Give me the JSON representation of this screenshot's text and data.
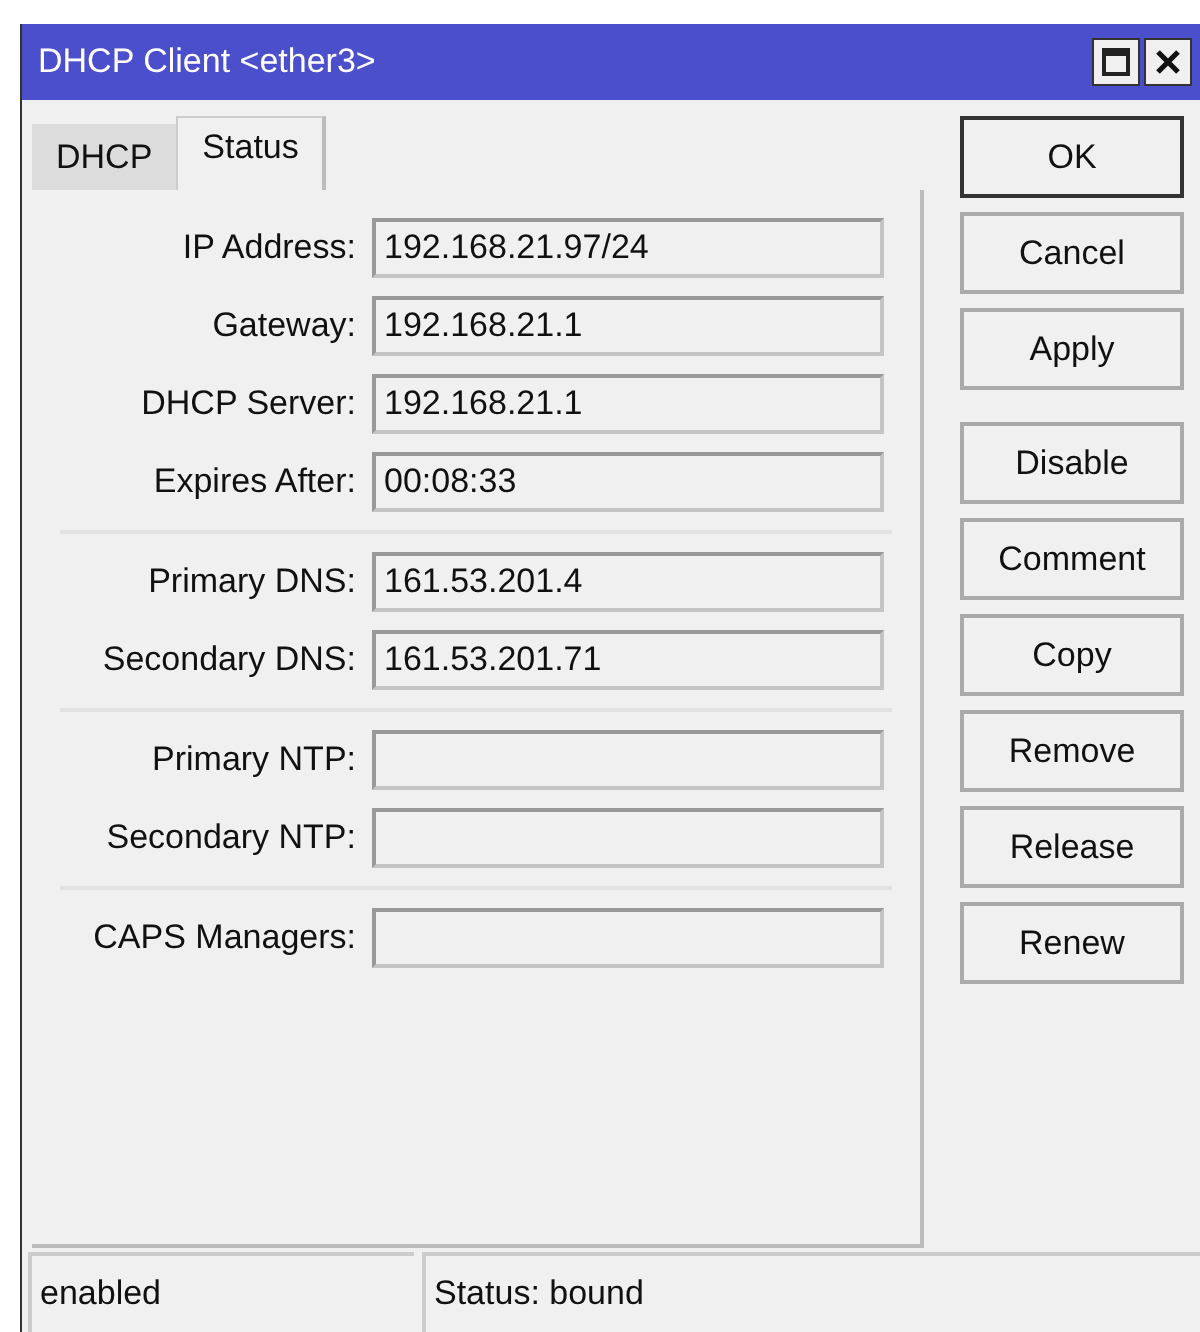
{
  "window": {
    "title": "DHCP Client <ether3>"
  },
  "tabs": [
    {
      "label": "DHCP",
      "selected": false
    },
    {
      "label": "Status",
      "selected": true
    }
  ],
  "field_groups": [
    [
      {
        "label": "IP Address:",
        "value": "192.168.21.97/24"
      },
      {
        "label": "Gateway:",
        "value": "192.168.21.1"
      },
      {
        "label": "DHCP Server:",
        "value": "192.168.21.1"
      },
      {
        "label": "Expires After:",
        "value": "00:08:33"
      }
    ],
    [
      {
        "label": "Primary DNS:",
        "value": "161.53.201.4"
      },
      {
        "label": "Secondary DNS:",
        "value": "161.53.201.71"
      }
    ],
    [
      {
        "label": "Primary NTP:"
      },
      {
        "label": "Secondary NTP:"
      }
    ],
    [
      {
        "label": "CAPS Managers:"
      }
    ]
  ],
  "button_groups": [
    [
      {
        "label": "OK",
        "default": true
      },
      {
        "label": "Cancel",
        "default": false
      },
      {
        "label": "Apply",
        "default": false
      }
    ],
    [
      {
        "label": "Disable",
        "default": false
      },
      {
        "label": "Comment",
        "default": false
      },
      {
        "label": "Copy",
        "default": false
      },
      {
        "label": "Remove",
        "default": false
      },
      {
        "label": "Release",
        "default": false
      },
      {
        "label": "Renew",
        "default": false
      }
    ]
  ],
  "status_bar": [
    "enabled",
    "Status: bound"
  ]
}
